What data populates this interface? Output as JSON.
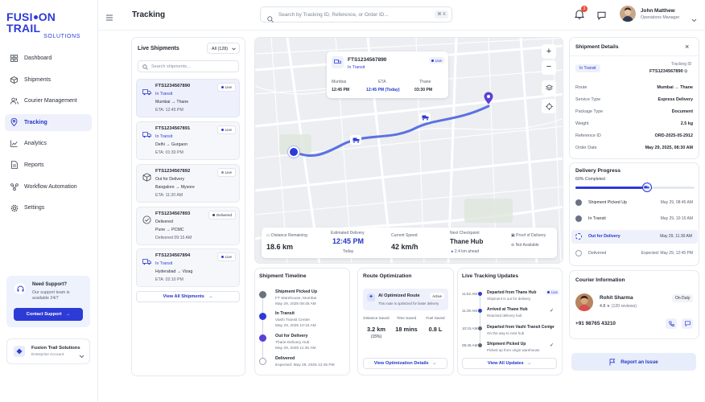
{
  "brand": {
    "name_line1": "FUSI",
    "name_line1b": "ON TRAIL",
    "name_line2": "SOLUTIONS",
    "color": "#2d3bd6"
  },
  "nav": [
    {
      "label": "Dashboard",
      "icon": "grid-icon"
    },
    {
      "label": "Shipments",
      "icon": "box-icon"
    },
    {
      "label": "Courier Management",
      "icon": "users-icon"
    },
    {
      "label": "Tracking",
      "icon": "location-pin-icon",
      "active": true
    },
    {
      "label": "Analytics",
      "icon": "chart-icon"
    },
    {
      "label": "Reports",
      "icon": "document-icon"
    },
    {
      "label": "Workflow Automation",
      "icon": "workflow-icon"
    },
    {
      "label": "Settings",
      "icon": "gear-icon"
    }
  ],
  "support": {
    "title": "Need Support?",
    "subtitle": "Our support team is available 24/7",
    "button": "Contact Support"
  },
  "org": {
    "name": "Fusion Trail Solutions",
    "plan": "Enterprise Account"
  },
  "header": {
    "title": "Tracking",
    "search_placeholder": "Search by Tracking ID, Reference, or Order ID...",
    "shortcut": "⌘ K",
    "notifications": "3",
    "user_name": "John Matthew",
    "user_role": "Operations Manager"
  },
  "live": {
    "title": "Live Shipments",
    "filter": "All (128)",
    "search_placeholder": "Search shipments...",
    "cards": [
      {
        "id": "FTS1234567890",
        "status": "In Transit",
        "route": "Mumbai → Thane",
        "eta": "ETA: 12:45 PM",
        "badge": "Live"
      },
      {
        "id": "FTS1234567891",
        "status": "In Transit",
        "route": "Delhi → Gurgaon",
        "eta": "ETA: 01:30 PM",
        "badge": "Live"
      },
      {
        "id": "FTS1234567892",
        "status": "Out for Delivery",
        "route": "Bangalore → Mysore",
        "eta": "ETA: 11:20 AM",
        "badge": "Live"
      },
      {
        "id": "FTS1234567893",
        "status": "Delivered",
        "route": "Pune → PCMC",
        "eta": "Delivered 09:15 AM",
        "badge": "Delivered"
      },
      {
        "id": "FTS1234567894",
        "status": "In Transit",
        "route": "Hyderabad → Vizag",
        "eta": "ETA: 02:10 PM",
        "badge": "Live"
      }
    ],
    "view_all": "View All Shipments"
  },
  "map_card": {
    "id": "FTS1234567890",
    "status": "In Transit",
    "badge": "Live",
    "from_label": "Mumbai",
    "from_time": "12:45 PM",
    "eta_label": "ETA",
    "eta_time": "12:45 PM (Today)",
    "to_label": "Thane",
    "to_time": "03:30 PM"
  },
  "stats": {
    "dist_label": "Distance Remaining",
    "dist_val": "18.6 km",
    "est_label": "Estimated Delivery",
    "est_val": "12:45 PM",
    "est_sub": "Today",
    "speed_label": "Current Speed",
    "speed_val": "42 km/h",
    "next_label": "Next Checkpoint",
    "next_val": "Thane Hub",
    "next_sub": "2.4 km ahead",
    "pod_label": "Proof of Delivery",
    "pod_val": "Not Available"
  },
  "timeline": {
    "title": "Shipment Timeline",
    "items": [
      {
        "t": "Shipment Picked Up",
        "s1": "FT Warehouse, Mumbai",
        "s2": "May 29, 2025 08:45 AM"
      },
      {
        "t": "In Transit",
        "s1": "Vashi Transit Center",
        "s2": "May 29, 2025 10:15 AM"
      },
      {
        "t": "Out for Delivery",
        "s1": "Thane Delivery Hub",
        "s2": "May 29, 2025 11:30 AM"
      },
      {
        "t": "Delivered",
        "s1": "Expected: May 29, 2025 12:45 PM",
        "s2": ""
      }
    ]
  },
  "route_opt": {
    "title": "Route Optimization",
    "ai_title": "AI Optimized Route",
    "ai_badge": "Active",
    "ai_sub": "This route is optimized for faster delivery",
    "c1_l": "Distance Saved",
    "c1_v": "3.2 km",
    "c1_s": "(15%)",
    "c2_l": "Time Saved",
    "c2_v": "18 mins",
    "c3_l": "Fuel Saved",
    "c3_v": "0.8 L",
    "button": "View Optimization Details"
  },
  "updates": {
    "title": "Live Tracking Updates",
    "badge": "Live",
    "items": [
      {
        "time": "11:52 AM",
        "t": "Departed from Thane Hub",
        "s": "Shipment is out for delivery"
      },
      {
        "time": "11:30 AM",
        "t": "Arrived at Thane Hub",
        "s": "Reached delivery hub"
      },
      {
        "time": "10:15 AM",
        "t": "Departed from Vashi Transit Center",
        "s": "On the way to next hub"
      },
      {
        "time": "08:45 AM",
        "t": "Shipment Picked Up",
        "s": "Picked up from origin warehouse"
      }
    ],
    "button": "View All Updates"
  },
  "details": {
    "title": "Shipment Details",
    "status": "In Transit",
    "tid_label": "Tracking ID",
    "tid": "FTS1234567890",
    "rows": [
      {
        "k": "Route",
        "v": "Mumbai → Thane"
      },
      {
        "k": "Service Type",
        "v": "Express Delivery"
      },
      {
        "k": "Package Type",
        "v": "Document"
      },
      {
        "k": "Weight",
        "v": "2.5 kg"
      },
      {
        "k": "Reference ID",
        "v": "ORD-2025-05-2912"
      },
      {
        "k": "Order Date",
        "v": "May 29, 2025, 08:30 AM"
      }
    ]
  },
  "progress": {
    "title": "Delivery Progress",
    "completed": "60% Completed",
    "fraction": 0.6,
    "steps": [
      {
        "t": "Shipment Picked Up",
        "d": "May 29, 08:45 AM"
      },
      {
        "t": "In Transit",
        "d": "May 29, 10:15 AM"
      },
      {
        "t": "Out for Delivery",
        "d": "May 29, 11:30 AM"
      },
      {
        "t": "Delivered",
        "d": "Expected: May 29, 12:45 PM"
      }
    ]
  },
  "courier": {
    "title": "Courier Information",
    "name": "Rohit Sharma",
    "rating": "4.8",
    "reviews": "(120 reviews)",
    "status": "On Duty",
    "phone": "+91 98765 43210"
  },
  "issue_button": "Report an Issue"
}
